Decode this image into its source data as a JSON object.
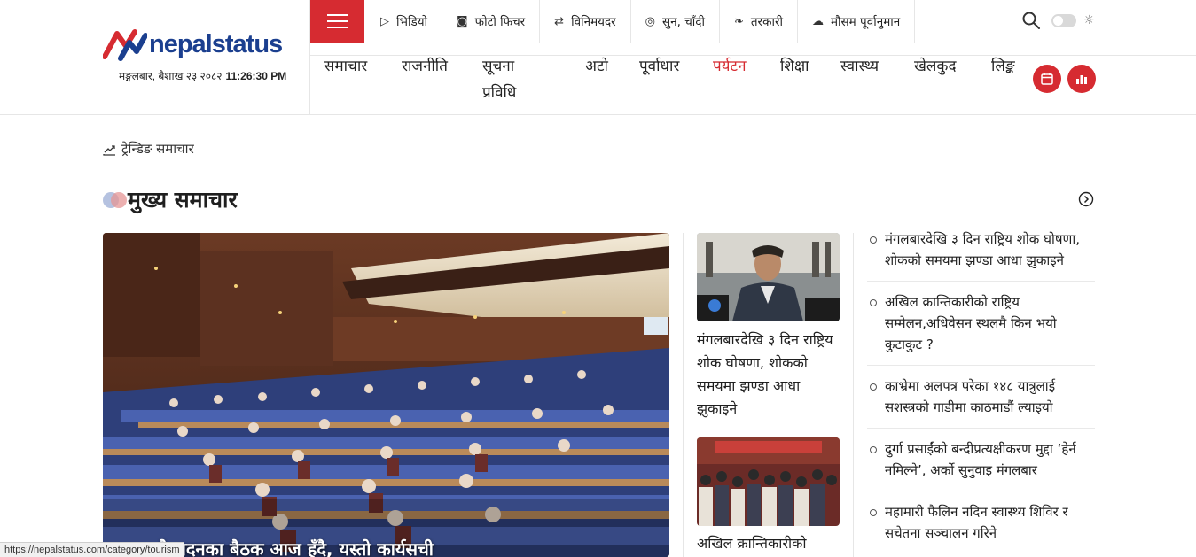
{
  "brand": {
    "logo_text": "nepalstatus",
    "date": "मङ्गलबार, बैशाख २३ २०८२",
    "time": "11:26:30 PM",
    "colors": {
      "primary": "#d62b31",
      "brand_blue": "#1b3f8f"
    }
  },
  "quick_links": [
    {
      "icon": "play-circle-icon",
      "glyph": "▷",
      "label": "भिडियो"
    },
    {
      "icon": "camera-icon",
      "glyph": "◙",
      "label": "फोटो फिचर"
    },
    {
      "icon": "exchange-icon",
      "glyph": "⇄",
      "label": "विनिमयदर"
    },
    {
      "icon": "coins-icon",
      "glyph": "◎",
      "label": "सुन, चाँदी"
    },
    {
      "icon": "leaf-icon",
      "glyph": "❧",
      "label": "तरकारी"
    },
    {
      "icon": "cloud-sun-icon",
      "glyph": "☁",
      "label": "मौसम पूर्वानुमान"
    }
  ],
  "main_nav": [
    {
      "label": "समाचार",
      "active": false
    },
    {
      "label": "राजनीति",
      "active": false
    },
    {
      "label": "सूचना प्रविधि",
      "active": false
    },
    {
      "label": "अटो",
      "active": false
    },
    {
      "label": "पूर्वाधार",
      "active": false
    },
    {
      "label": "पर्यटन",
      "active": true
    },
    {
      "label": "शिक्षा",
      "active": false
    },
    {
      "label": "स्वास्थ्य",
      "active": false
    },
    {
      "label": "खेलकुद",
      "active": false
    },
    {
      "label": "लिङ्क",
      "active": false
    }
  ],
  "trending": {
    "label": "ट्रेन्डिङ समाचार"
  },
  "section": {
    "title": "मुख्य समाचार"
  },
  "feature": {
    "headline": "सदका दवै सदनका बैठक आज हँदै, यस्तो कार्यसची"
  },
  "middle": [
    {
      "headline": "मंगलबारदेखि ३ दिन राष्ट्रिय शोक घोषणा, शोकको समयमा झण्डा आधा झुकाइने"
    },
    {
      "headline": "अखिल क्रान्तिकारीको"
    }
  ],
  "news_list": [
    "मंगलबारदेखि ३ दिन राष्ट्रिय शोक घोषणा, शोकको समयमा झण्डा आधा झुकाइने",
    "अखिल क्रान्तिकारीको राष्ट्रिय सम्मेलन,अधिवेसन स्थलमै किन भयो कुटाकुट ?",
    "काभ्रेमा अलपत्र परेका १४८ यात्रुलाई सशस्त्रको गाडीमा काठमाडौं ल्याइयो",
    "दुर्गा प्रसाईंको बन्दीप्रत्यक्षीकरण मुद्दा ‘हेर्न नमिल्ने’, अर्को सुनुवाइ मंगलबार",
    " महामारी फैलिन नदिन स्वास्थ्य शिविर र सचेतना सञ्चालन गरिने"
  ],
  "status_bar": {
    "url": "https://nepalstatus.com/category/tourism"
  }
}
